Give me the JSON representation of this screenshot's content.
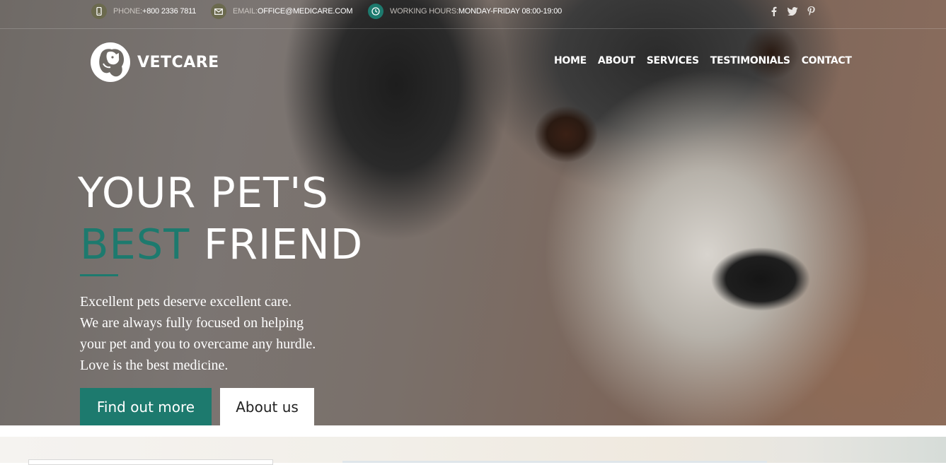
{
  "topbar": {
    "phone": {
      "label": "PHONE:",
      "value": "+800 2336 7811",
      "icon": "phone-icon",
      "icon_color": "#6b6a4e"
    },
    "email": {
      "label": "EMAIL:",
      "value": "OFFICE@MEDICARE.COM",
      "icon": "mail-icon",
      "icon_color": "#6b6a4e"
    },
    "hours": {
      "label": "WORKING HOURS:",
      "value": "MONDAY-FRIDAY 08:00-19:00",
      "icon": "clock-icon",
      "icon_color": "#1d7a6e"
    },
    "social": [
      "facebook-icon",
      "twitter-icon",
      "pinterest-icon"
    ]
  },
  "brand": {
    "name": "VETCARE",
    "logo_icon": "dog-cat-logo-icon"
  },
  "nav": [
    "HOME",
    "ABOUT",
    "SERVICES",
    "TESTIMONIALS",
    "CONTACT"
  ],
  "hero": {
    "line1": "YOUR PET'S",
    "line2_accent": "BEST",
    "line2_rest": "FRIEND",
    "description": [
      "Excellent pets deserve excellent care.",
      "We are always fully focused on helping",
      "your pet and you to overcame any hurdle.",
      "Love is the best medicine."
    ],
    "primary_button": "Find out more",
    "secondary_button": "About us"
  },
  "colors": {
    "accent": "#1d7a6e",
    "white": "#ffffff"
  }
}
